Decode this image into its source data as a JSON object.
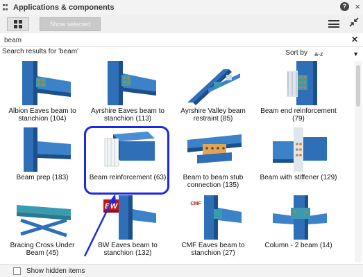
{
  "window": {
    "title": "Applications & components"
  },
  "toolbar": {
    "show_selected_label": "Show selected"
  },
  "search": {
    "value": "beam",
    "placeholder": ""
  },
  "results": {
    "label": "Search results for 'beam'"
  },
  "sort": {
    "label": "Sort by",
    "value": "a-z"
  },
  "items": [
    {
      "label": "Albion Eaves beam to stanchion (104)"
    },
    {
      "label": "Ayrshire Eaves beam to stanchion (113)"
    },
    {
      "label": "Ayrshire Valley beam restraint (85)"
    },
    {
      "label": "Beam end reinforcement (79)"
    },
    {
      "label": "Beam prep (183)"
    },
    {
      "label": "Beam reinforcement (63)"
    },
    {
      "label": "Beam to beam stub connection (135)"
    },
    {
      "label": "Beam with stiffener (129)"
    },
    {
      "label": "Bracing Cross Under Beam (45)"
    },
    {
      "label": "BW Eaves beam to stanchion (132)"
    },
    {
      "label": "CMF Eaves beam to stanchion (27)"
    },
    {
      "label": "Column - 2 beam (14)"
    }
  ],
  "logos": {
    "bw": "BW",
    "cmf": "CMF"
  },
  "footer": {
    "show_hidden_label": "Show hidden items"
  },
  "colors": {
    "steel_blue": "#2f6fb7",
    "highlight": "#1d28e6",
    "plate_teal": "#3a9ab0"
  }
}
